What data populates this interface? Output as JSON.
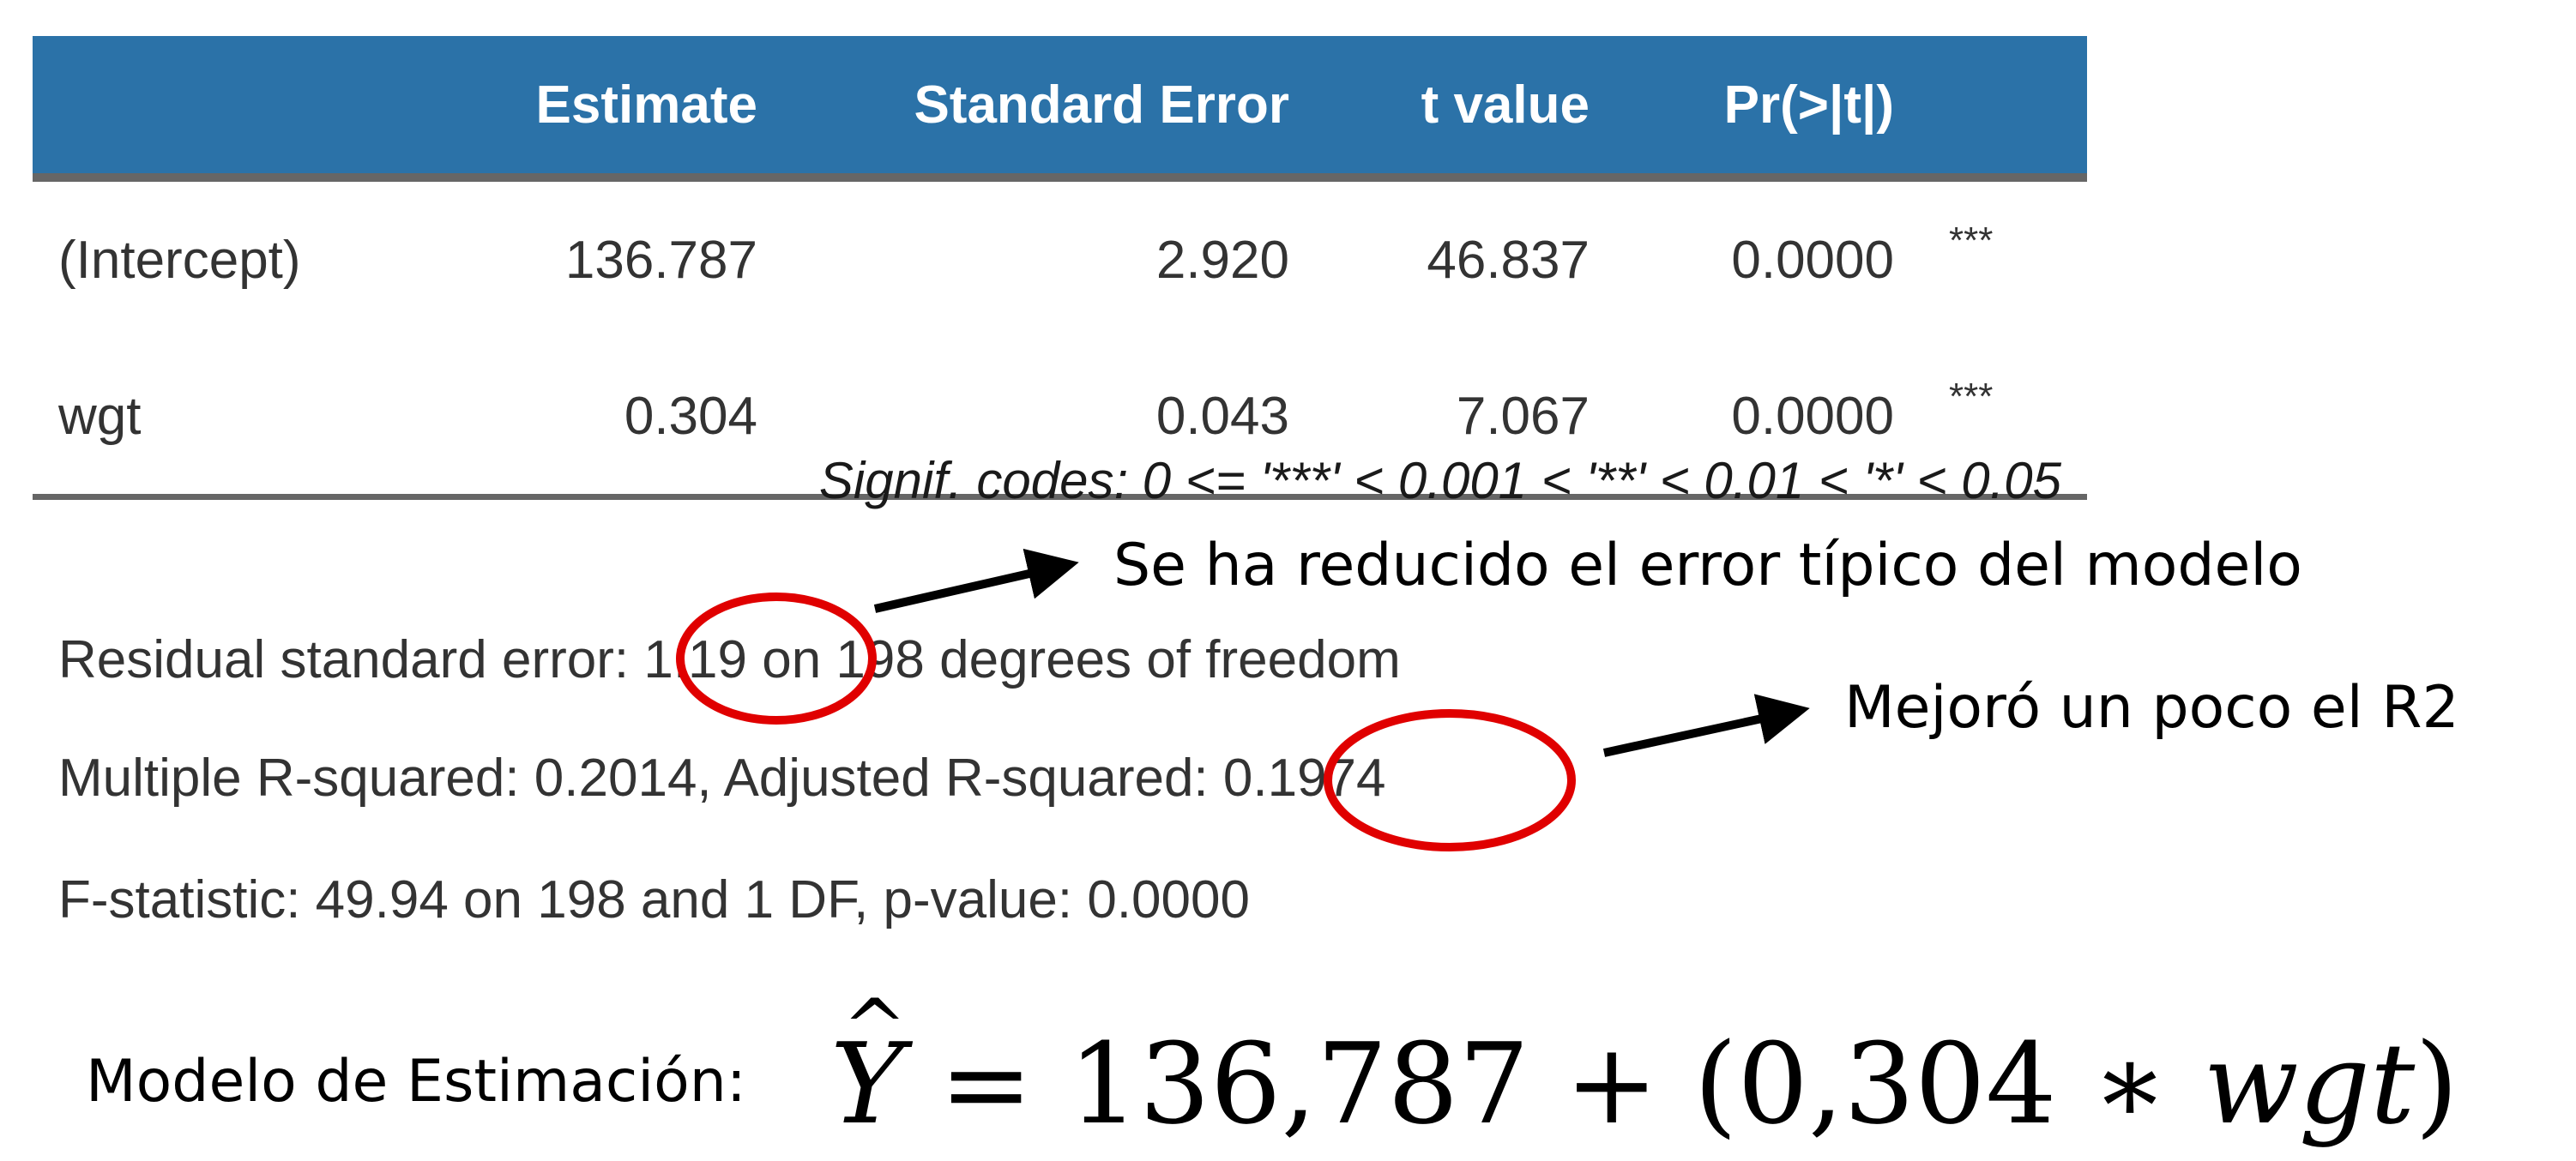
{
  "table": {
    "headers": [
      "",
      "Estimate",
      "Standard Error",
      "t value",
      "Pr(>|t|)",
      ""
    ],
    "rows": [
      {
        "name": "(Intercept)",
        "estimate": "136.787",
        "std_error": "2.920",
        "t_value": "46.837",
        "p_value": "0.0000",
        "signif": "***"
      },
      {
        "name": "wgt",
        "estimate": "0.304",
        "std_error": "0.043",
        "t_value": "7.067",
        "p_value": "0.0000",
        "signif": "***"
      }
    ]
  },
  "signif_codes": "Signif. codes: 0 <= '***' < 0.001 < '**' < 0.01 < '*' < 0.05",
  "summary": {
    "line1_pre": "Residual standard error: ",
    "line1_value": "1.19",
    "line1_post": " on 198 degrees of freedom",
    "line2_pre": "Multiple R-squared: 0.2014, Adjusted R-squared: ",
    "line2_value": "0.1974",
    "line3": "F-statistic: 49.94 on 198 and 1 DF, p-value: 0.0000"
  },
  "annotations": {
    "note1": "Se ha reducido el error típico del modelo",
    "note2": "Mejoró un poco el R2",
    "highlight_color": "#e00000"
  },
  "model": {
    "label": "Modelo de Estimación:",
    "y": "Y",
    "hat": "^",
    "equals": "=",
    "intercept": "136,787",
    "plus": "+",
    "open": "(",
    "coef": "0,304",
    "times": "∗",
    "var": "wgt",
    "close": ")"
  }
}
